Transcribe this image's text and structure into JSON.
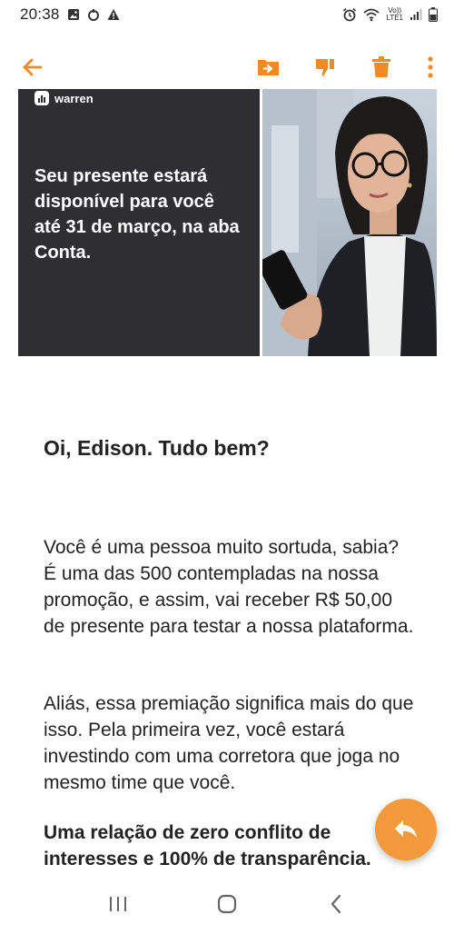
{
  "status_bar": {
    "time": "20:38",
    "icons_left": [
      "image-icon",
      "data-saver-icon",
      "warning-icon"
    ],
    "icons_right": [
      "alarm-icon",
      "wifi-icon",
      "volte-lte-icon",
      "signal-icon",
      "battery-icon"
    ],
    "volte_label_top": "Vo))",
    "volte_label_bottom": "LTE1"
  },
  "toolbar": {
    "accent_color": "#f08a24",
    "actions": [
      "back",
      "move-to-folder",
      "dislike",
      "delete",
      "more-options"
    ]
  },
  "email": {
    "brand": "warren",
    "banner_text": "Seu presente estará disponível para você até 31 de março, na aba Conta.",
    "greeting": "Oi, Edison. Tudo bem?",
    "paragraph_1": "Você é uma pessoa muito sortuda, sabia? É uma das 500 contempladas na nossa promoção, e assim, vai receber R$ 50,00 de presente para testar a nossa plataforma.",
    "paragraph_2": "Aliás, essa premiação significa mais do que isso. Pela primeira vez, você estará investindo com uma corretora que joga no mesmo time que você.",
    "paragraph_3": "Uma relação de zero conflito de interesses e 100% de transparência."
  },
  "fab": {
    "icon": "reply-icon",
    "color": "#f39a3c"
  },
  "nav_bar": {
    "buttons": [
      "recent-apps",
      "home",
      "back"
    ]
  }
}
